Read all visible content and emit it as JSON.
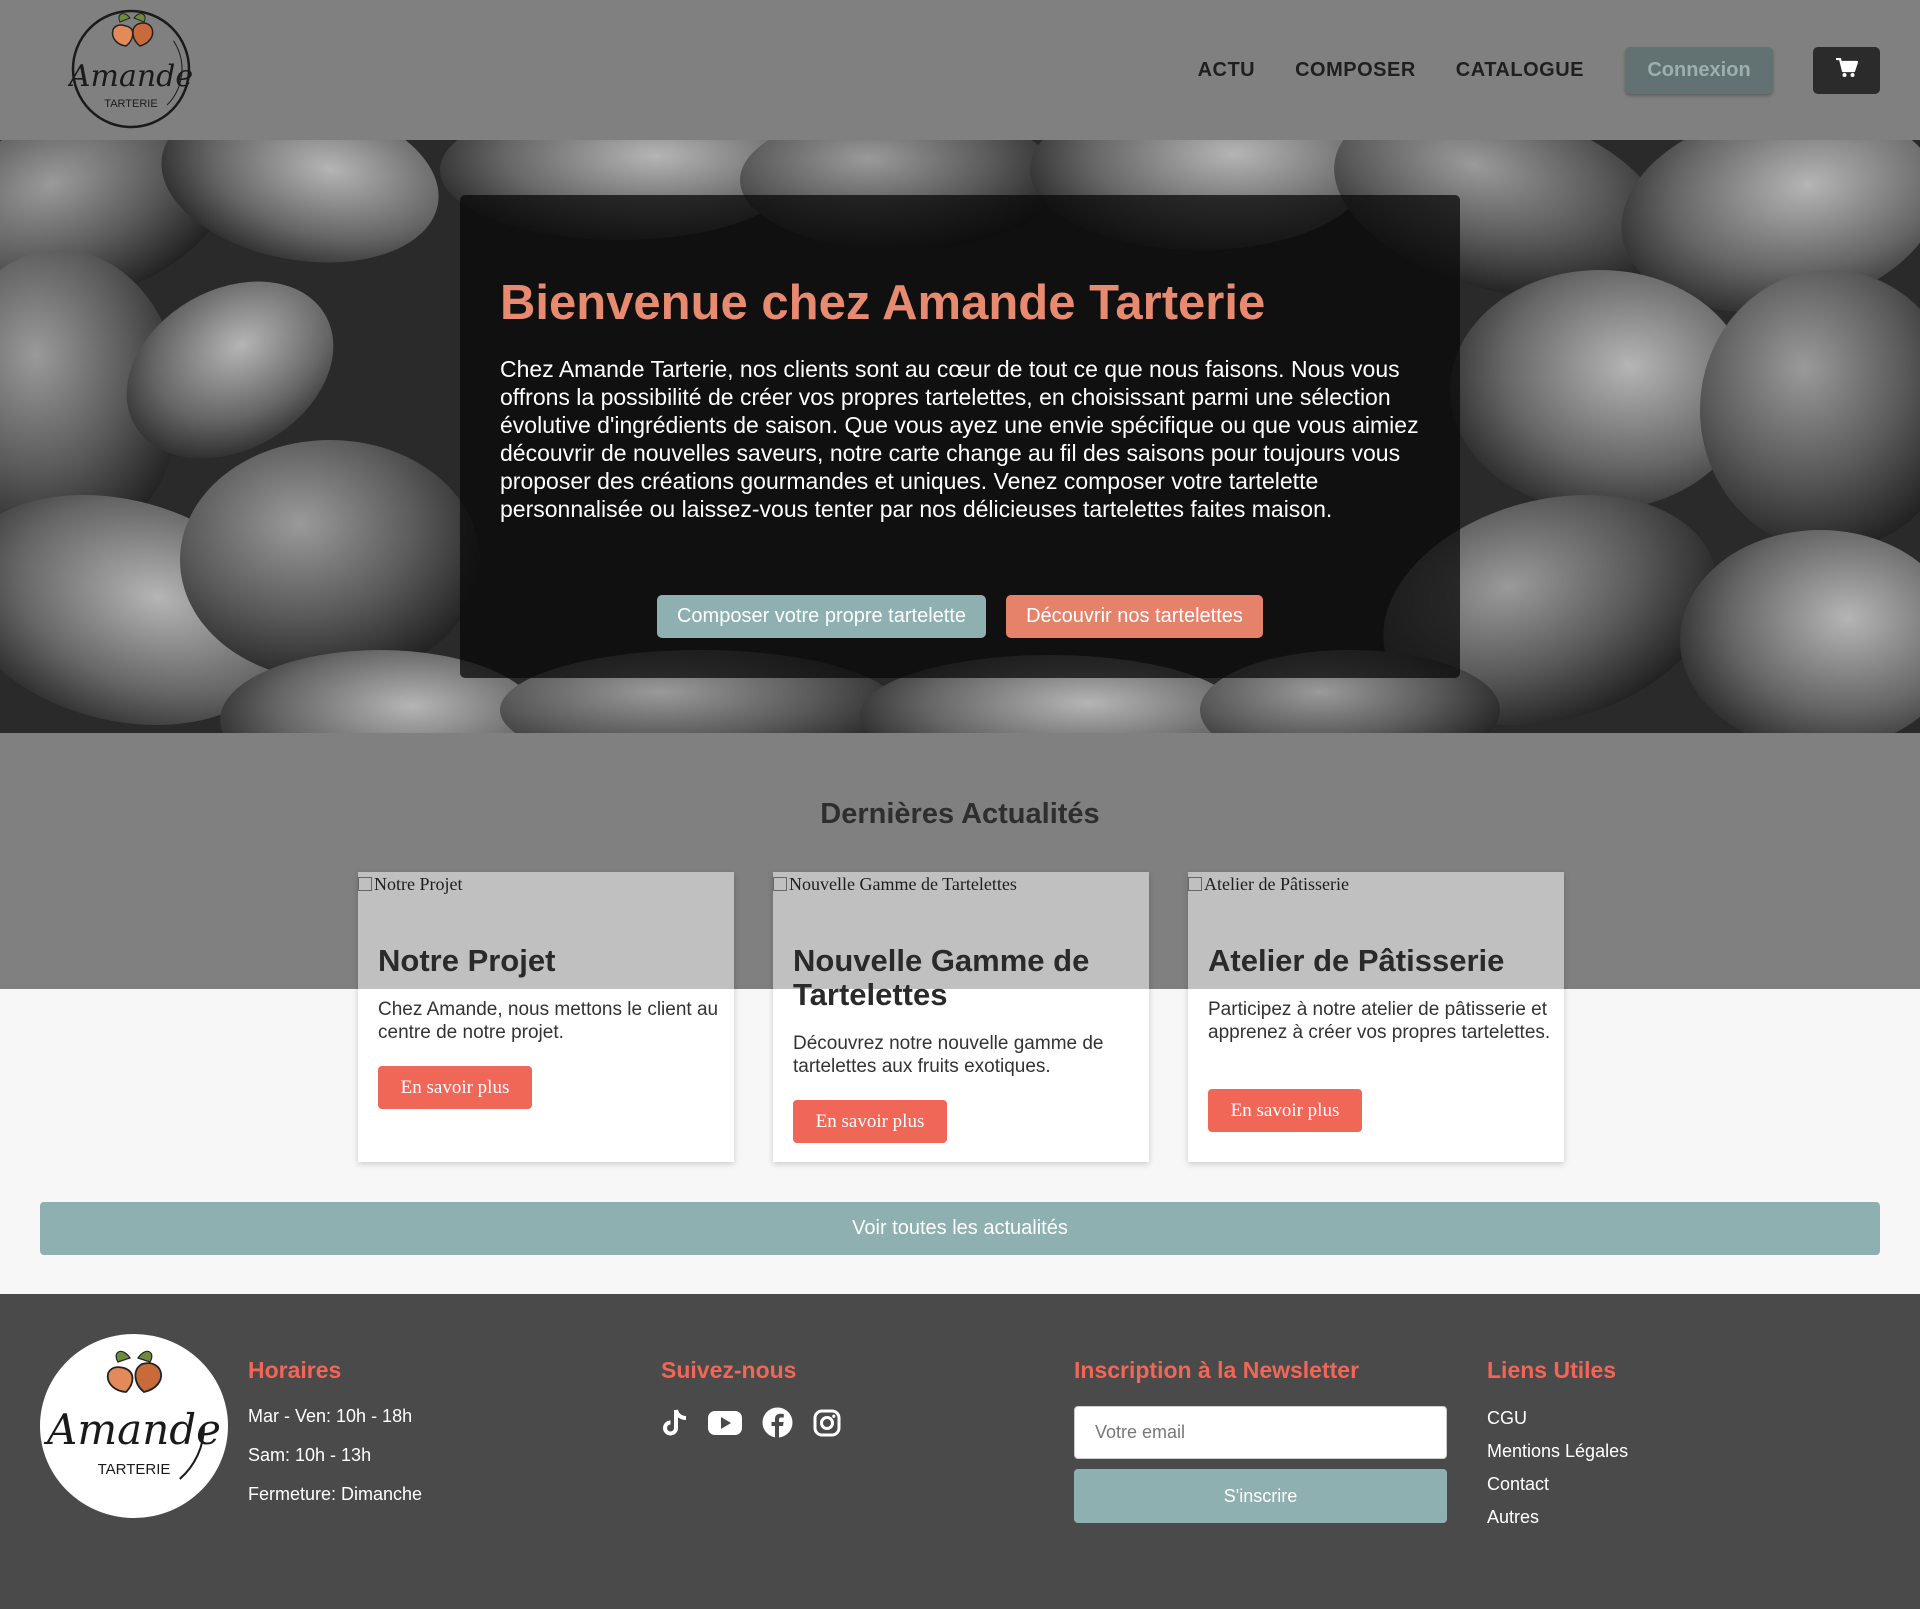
{
  "brand": {
    "name": "Amande",
    "subname": "TARTERIE"
  },
  "nav": {
    "links": [
      "ACTU",
      "COMPOSER",
      "CATALOGUE"
    ],
    "login": "Connexion",
    "cart_icon": "shopping-cart-icon"
  },
  "hero": {
    "title": "Bienvenue chez Amande Tarterie",
    "text": "Chez Amande Tarterie, nos clients sont au cœur de tout ce que nous faisons. Nous vous offrons la possibilité de créer vos propres tartelettes, en choisissant parmi une sélection évolutive d'ingrédients de saison. Que vous ayez une envie spécifique ou que vous aimiez découvrir de nouvelles saveurs, notre carte change au fil des saisons pour toujours vous proposer des créations gourmandes et uniques. Venez composer votre tartelette personnalisée ou laissez-vous tenter par nos délicieuses tartelettes faites maison.",
    "btn_compose": "Composer votre propre tartelette",
    "btn_discover": "Découvrir nos tartelettes"
  },
  "news": {
    "title": "Dernières Actualités",
    "cards": [
      {
        "img_alt": "Notre Projet",
        "title": "Notre Projet",
        "text": "Chez Amande, nous mettons le client au centre de notre projet.",
        "button": "En savoir plus"
      },
      {
        "img_alt": "Nouvelle Gamme de Tartelettes",
        "title": "Nouvelle Gamme de Tartelettes",
        "text": "Découvrez notre nouvelle gamme de tartelettes aux fruits exotiques.",
        "button": "En savoir plus"
      },
      {
        "img_alt": "Atelier de Pâtisserie",
        "title": "Atelier de Pâtisserie",
        "text": "Participez à notre atelier de pâtisserie et apprenez à créer vos propres tartelettes.",
        "button": "En savoir plus"
      }
    ],
    "all_button": "Voir toutes les actualités"
  },
  "footer": {
    "hours": {
      "title": "Horaires",
      "lines": [
        "Mar - Ven: 10h - 18h",
        "Sam: 10h - 13h",
        "Fermeture: Dimanche"
      ]
    },
    "social": {
      "title": "Suivez-nous",
      "icons": [
        "tiktok-icon",
        "youtube-icon",
        "facebook-icon",
        "instagram-icon"
      ]
    },
    "newsletter": {
      "title": "Inscription à la Newsletter",
      "placeholder": "Votre email",
      "button": "S'inscrire"
    },
    "links": {
      "title": "Liens Utiles",
      "items": [
        "CGU",
        "Mentions Légales",
        "Contact",
        "Autres"
      ]
    }
  },
  "colors": {
    "accent_coral": "#f06657",
    "hero_title": "#e88a70",
    "teal": "#8fb0b0",
    "header_bg": "#808080",
    "footer_bg": "#4a4a4a"
  }
}
